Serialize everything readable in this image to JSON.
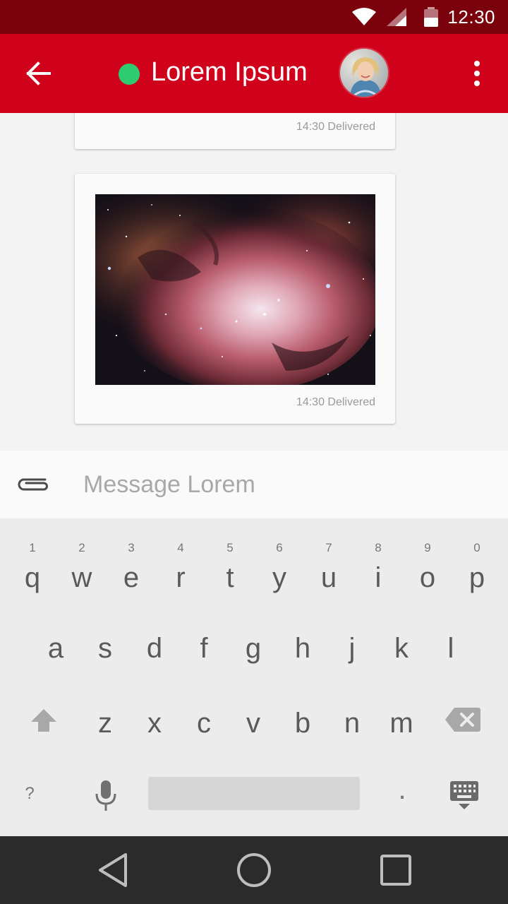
{
  "status_bar": {
    "time": "12:30",
    "icons": [
      "wifi-icon",
      "cell-signal-icon",
      "battery-icon"
    ]
  },
  "app_bar": {
    "title": "Lorem Ipsum",
    "presence_status_color": "#2ecc71",
    "accent_color": "#d0021b",
    "icons": [
      "back-arrow-icon",
      "avatar",
      "more-vert-icon"
    ]
  },
  "messages": [
    {
      "time": "14:30",
      "status": "Delivered",
      "meta": "14:30 Delivered",
      "type": "text"
    },
    {
      "time": "14:30",
      "status": "Delivered",
      "meta": "14:30 Delivered",
      "type": "image",
      "image_subject": "nebula"
    }
  ],
  "composer": {
    "placeholder": "Message Lorem",
    "value": "",
    "attach_icon": "paperclip-icon"
  },
  "keyboard": {
    "row1": [
      {
        "key": "q",
        "hint": "1"
      },
      {
        "key": "w",
        "hint": "2"
      },
      {
        "key": "e",
        "hint": "3"
      },
      {
        "key": "r",
        "hint": "4"
      },
      {
        "key": "t",
        "hint": "5"
      },
      {
        "key": "y",
        "hint": "6"
      },
      {
        "key": "u",
        "hint": "7"
      },
      {
        "key": "i",
        "hint": "8"
      },
      {
        "key": "o",
        "hint": "9"
      },
      {
        "key": "p",
        "hint": "0"
      }
    ],
    "row2": [
      "a",
      "s",
      "d",
      "f",
      "g",
      "h",
      "j",
      "k",
      "l"
    ],
    "row3": [
      "z",
      "x",
      "c",
      "v",
      "b",
      "n",
      "m"
    ],
    "symbols_key": "?",
    "period_key": ".",
    "special_icons": [
      "shift-icon",
      "backspace-icon",
      "mic-icon",
      "keyboard-icon"
    ]
  },
  "nav_bar": {
    "icons": [
      "nav-back-icon",
      "nav-home-icon",
      "nav-recents-icon"
    ]
  }
}
